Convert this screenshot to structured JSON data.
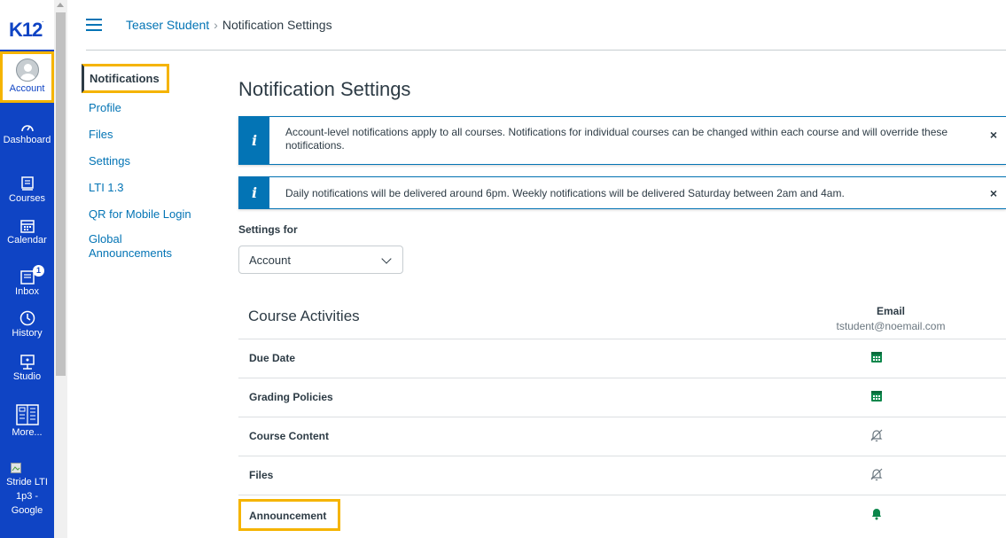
{
  "brand": {
    "logo": "K12"
  },
  "global_nav": [
    {
      "label": "Account",
      "icon": "avatar"
    },
    {
      "label": "Dashboard",
      "icon": "dashboard-icon"
    },
    {
      "label": "Courses",
      "icon": "courses-icon"
    },
    {
      "label": "Calendar",
      "icon": "calendar-icon"
    },
    {
      "label": "Inbox",
      "icon": "inbox-icon",
      "badge": "1"
    },
    {
      "label": "History",
      "icon": "history-icon"
    },
    {
      "label": "Studio",
      "icon": "studio-icon"
    },
    {
      "label": "More...",
      "icon": "more-icon"
    },
    {
      "label": "Stride LTI 1p3 - Google",
      "icon": "broken-image-icon"
    }
  ],
  "breadcrumb": {
    "parent": "Teaser Student",
    "separator": "›",
    "current": "Notification Settings"
  },
  "subnav": [
    {
      "label": "Notifications",
      "active": true
    },
    {
      "label": "Profile"
    },
    {
      "label": "Files"
    },
    {
      "label": "Settings"
    },
    {
      "label": "LTI 1.3"
    },
    {
      "label": "QR for Mobile Login"
    },
    {
      "label": "Global Announcements"
    }
  ],
  "page_title": "Notification Settings",
  "alerts": [
    {
      "text": "Account-level notifications apply to all courses. Notifications for individual courses can be changed within each course and will override these notifications.",
      "close": "×"
    },
    {
      "text": "Daily notifications will be delivered around 6pm. Weekly notifications will be delivered Saturday between 2am and 4am.",
      "close": "×"
    }
  ],
  "settings_for": {
    "label": "Settings for",
    "selected": "Account"
  },
  "table": {
    "title": "Course Activities",
    "column": "Email",
    "email": "tstudent@noemail.com",
    "rows": [
      {
        "label": "Due Date",
        "setting": "daily-summary-icon"
      },
      {
        "label": "Grading Policies",
        "setting": "daily-summary-icon"
      },
      {
        "label": "Course Content",
        "setting": "notifications-off-icon"
      },
      {
        "label": "Files",
        "setting": "notifications-off-icon"
      },
      {
        "label": "Announcement",
        "setting": "notify-immediately-icon"
      }
    ]
  },
  "colors": {
    "nav": "#0f44c4",
    "link": "#0374b5",
    "highlight": "#f5b400",
    "on": "#0b874b"
  }
}
